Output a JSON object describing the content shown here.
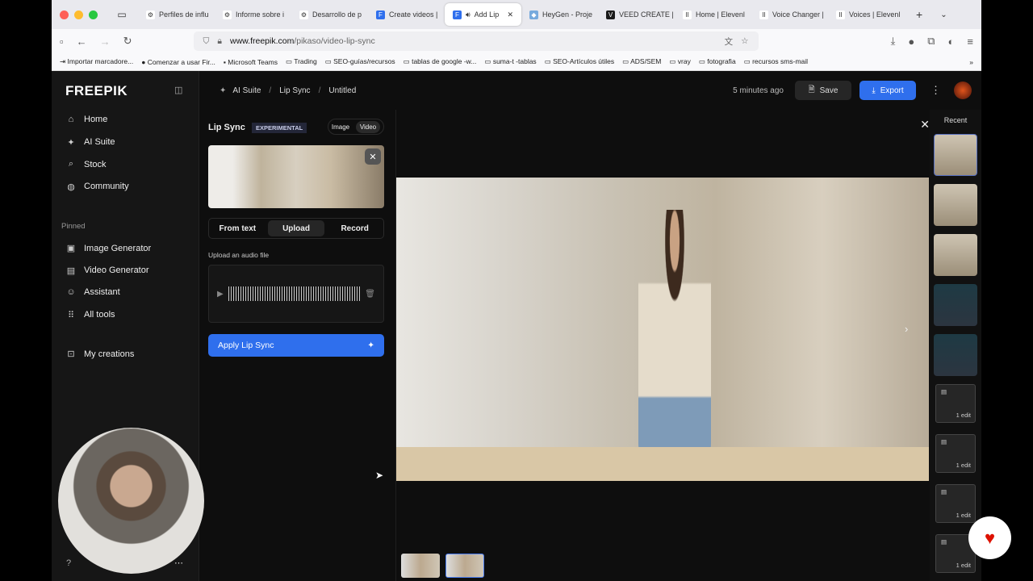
{
  "browser": {
    "tabs": [
      {
        "label": "Perfiles de influ",
        "icon": "chatgpt-icon"
      },
      {
        "label": "Informe sobre i",
        "icon": "chatgpt-icon"
      },
      {
        "label": "Desarrollo de p",
        "icon": "chatgpt-icon"
      },
      {
        "label": "Create videos |",
        "icon": "freepik-icon"
      },
      {
        "label": "Add Lip",
        "icon": "freepik-icon",
        "active": true
      },
      {
        "label": "HeyGen - Proje",
        "icon": "heygen-icon"
      },
      {
        "label": "VEED CREATE |",
        "icon": "veed-icon"
      },
      {
        "label": "Home | Elevenl",
        "icon": "elevenlabs-icon"
      },
      {
        "label": "Voice Changer |",
        "icon": "elevenlabs-icon"
      },
      {
        "label": "Voices | Elevenl",
        "icon": "elevenlabs-icon"
      }
    ],
    "url_domain": "www.freepik.com",
    "url_path": "/pikaso/video-lip-sync",
    "bookmarks": [
      "Importar marcadore...",
      "Comenzar a usar Fir...",
      "Microsoft Teams",
      "Trading",
      "SEO-guías/recursos",
      "tablas de google -w...",
      "suma-t -tablas",
      "SEO-Artículos útiles",
      "ADS/SEM",
      "vray",
      "fotografia",
      "recursos sms-mail"
    ]
  },
  "sidebar": {
    "logo": "FREEPIK",
    "items": [
      {
        "label": "Home",
        "icon": "⌂"
      },
      {
        "label": "AI Suite",
        "icon": "✦"
      },
      {
        "label": "Stock",
        "icon": "⌕"
      },
      {
        "label": "Community",
        "icon": "◍"
      }
    ],
    "pinned_label": "Pinned",
    "pinned": [
      {
        "label": "Image Generator",
        "icon": "▣"
      },
      {
        "label": "Video Generator",
        "icon": "▤"
      },
      {
        "label": "Assistant",
        "icon": "☺"
      },
      {
        "label": "All tools",
        "icon": "⠿"
      }
    ],
    "my_creations": "My creations"
  },
  "header": {
    "breadcrumb": [
      "AI Suite",
      "Lip Sync",
      "Untitled"
    ],
    "saved": "5 minutes ago",
    "save": "Save",
    "export": "Export"
  },
  "panel": {
    "title": "Lip Sync",
    "badge": "EXPERIMENTAL",
    "toggle": [
      "Image",
      "Video"
    ],
    "modes": [
      "From text",
      "Upload",
      "Record"
    ],
    "upload_label": "Upload an audio file",
    "apply": "Apply Lip Sync"
  },
  "recent": {
    "title": "Recent",
    "edits": [
      "1 edit",
      "1 edit",
      "1 edit",
      "1 edit"
    ]
  },
  "colors": {
    "accent": "#2f6fed"
  }
}
